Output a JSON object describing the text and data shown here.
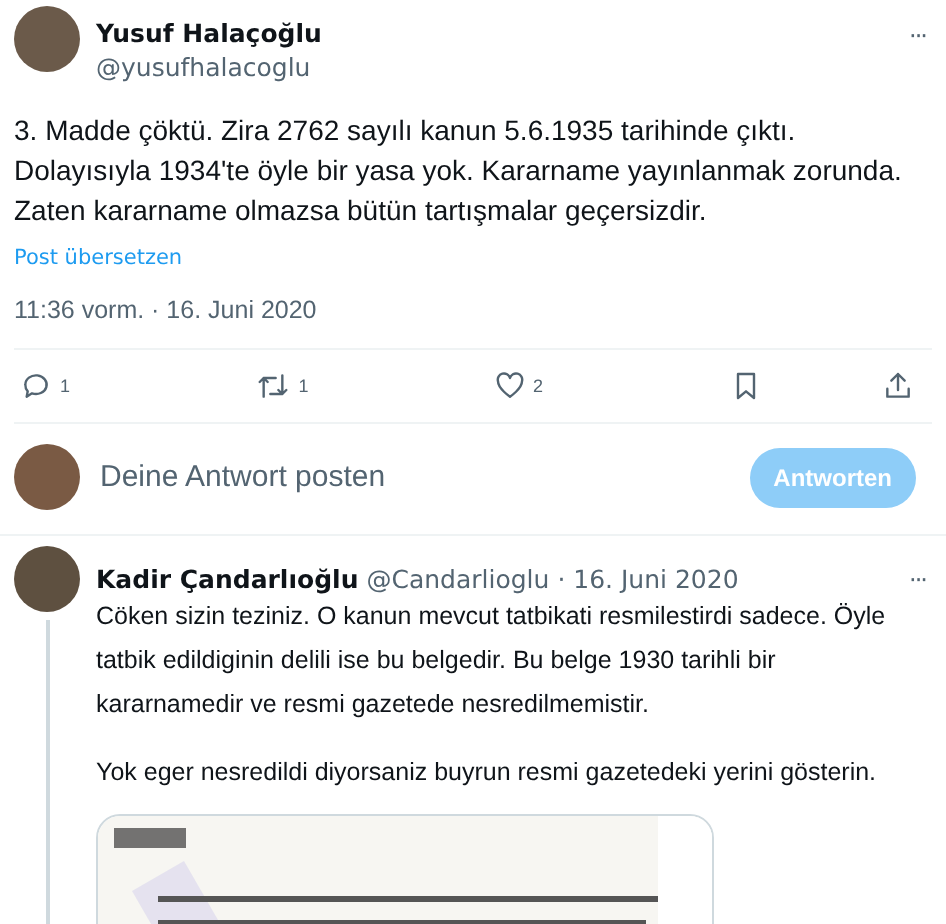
{
  "tweet": {
    "author": "Yusuf Halaçoğlu",
    "handle": "@yusufhalacoglu",
    "more": "···",
    "text": "3. Madde çöktü. Zira 2762 sayılı kanun 5.6.1935 tarihinde çıktı. Dolayısıyla 1934'te öyle bir yasa yok. Kararname yayınlanmak zorunda. Zaten kararname olmazsa bütün tartışmalar geçersizdir.",
    "translate": "Post übersetzen",
    "time": "11:36 vorm. · 16. Juni 2020"
  },
  "actions": [
    {
      "kind": "reply",
      "count": "1"
    },
    {
      "kind": "repost",
      "count": "1"
    },
    {
      "kind": "like",
      "count": "2"
    },
    {
      "kind": "bookmark"
    },
    {
      "kind": "share"
    }
  ],
  "composer": {
    "placeholder": "Deine Antwort posten",
    "button": "Antworten",
    "disabled": true
  },
  "reply": {
    "author": "Kadir Çandarlıoğlu",
    "handle": "@Candarlioglu",
    "date": "· 16. Juni 2020",
    "more": "···",
    "paragraphs": [
      "Cöken sizin teziniz. O kanun mevcut tatbikati resmilestirdi sadece. Öyle tatbik edildiginin delili ise bu belgedir. Bu belge 1930 tarihli bir kararnamedir ve resmi gazetede nesredilmemistir.",
      "Yok eger nesredildi diyorsaniz buyrun resmi gazetedeki yerini gösterin."
    ]
  }
}
